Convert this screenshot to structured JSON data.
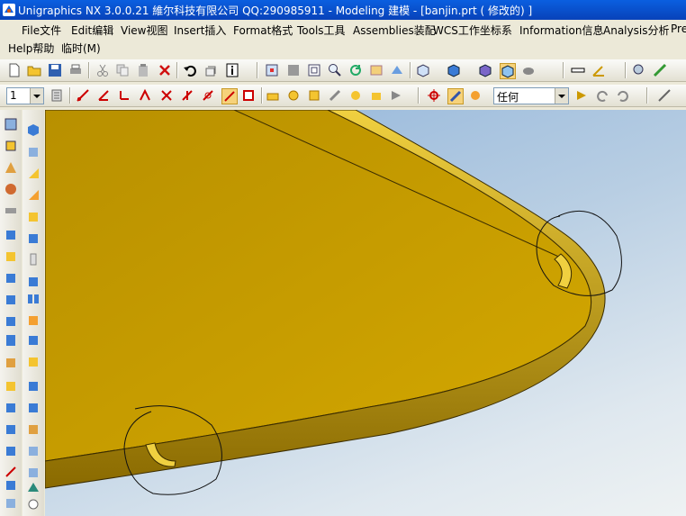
{
  "window": {
    "title": "Unigraphics NX 3.0.0.21  維尔科技有限公司 QQ:290985911 - Modeling 建模 - [banjin.prt ( 修改的) ]"
  },
  "menu": {
    "row1": [
      {
        "key": "file",
        "label": "File文件"
      },
      {
        "key": "edit",
        "label": "Edit编辑"
      },
      {
        "key": "view",
        "label": "View视图"
      },
      {
        "key": "insert",
        "label": "Insert插入"
      },
      {
        "key": "format",
        "label": "Format格式"
      },
      {
        "key": "tools",
        "label": "Tools工具"
      },
      {
        "key": "assemblies",
        "label": "Assemblies装配"
      },
      {
        "key": "wcs",
        "label": "WCS工作坐标系"
      },
      {
        "key": "information",
        "label": "Information信息"
      },
      {
        "key": "analysis",
        "label": "Analysis分析"
      },
      {
        "key": "preferences",
        "label": "Pre"
      }
    ],
    "row2": [
      {
        "key": "help",
        "label": "Help帮助"
      },
      {
        "key": "temp",
        "label": "临时(M)"
      }
    ]
  },
  "toolbar2": {
    "layer_value": "1",
    "filter_value": "任何"
  },
  "colors": {
    "model": "#c8a000",
    "model_edge": "#3a2c00",
    "accent": "#0a5fe0"
  },
  "icons": {
    "toolbar1": [
      "new-file-icon",
      "open-folder-icon",
      "save-icon",
      "print-icon",
      "cut-icon",
      "copy-icon",
      "paste-icon",
      "delete-icon",
      "undo-icon",
      "repeat-command-icon",
      "information-icon",
      "fit-view-icon",
      "shaded-view-icon",
      "zoom-window-icon",
      "zoom-icon",
      "rotate-icon",
      "pan-icon",
      "view-orient-icon",
      "wireframe-icon",
      "iso-view-icon",
      "solid-view-icon",
      "shaded-cube-icon",
      "render-icon",
      "measure-distance-icon",
      "measure-angle-icon",
      "analysis-icon",
      "section-icon"
    ],
    "toolbar2": [
      "layer-settings-icon",
      "sketch-line-icon",
      "sketch-axis-icon",
      "coordinate-icon",
      "point-icon",
      "plane-icon",
      "datum-axis-icon",
      "csys-icon",
      "select-edge-icon",
      "select-face-icon",
      "feature-icon",
      "body-icon",
      "component-icon",
      "snap-point-icon",
      "center-icon",
      "select-body-icon",
      "select-arrow-icon",
      "undo-select-icon",
      "redo-select-icon",
      "line-icon"
    ],
    "left_sidebar": [
      "block-icon",
      "cylinder-icon",
      "cone-icon",
      "sphere-icon",
      "tube-icon",
      "extrude-icon",
      "revolve-icon",
      "hole-icon",
      "boss-icon",
      "pocket-icon",
      "pad-icon",
      "slot-icon",
      "groove-icon",
      "thread-icon",
      "instance-icon",
      "trim-icon",
      "split-icon",
      "offset-icon",
      "chamfer-icon",
      "blend-icon"
    ],
    "right_sidebar": [
      "edge-blend-icon",
      "face-blend-icon",
      "shell-icon",
      "draft-icon",
      "scale-icon",
      "mirror-icon",
      "sew-icon",
      "patch-icon",
      "extract-icon",
      "bend-icon",
      "flange-icon",
      "sheet-metal-icon",
      "emboss-icon",
      "flat-pattern-icon",
      "unite-icon",
      "subtract-icon",
      "intersect-icon",
      "hollow-icon",
      "trim-body-icon",
      "layout-icon"
    ]
  }
}
